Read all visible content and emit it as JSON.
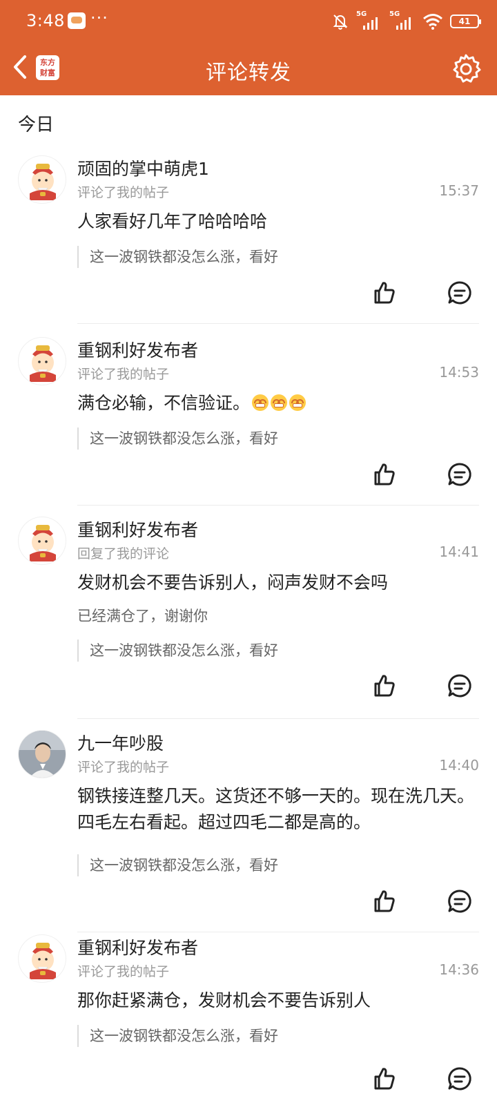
{
  "status_bar": {
    "time": "3:48",
    "more": "···",
    "network1": "5G",
    "network2": "5G",
    "battery": "41"
  },
  "nav": {
    "logo_line1": "东方",
    "logo_line2": "财富",
    "title": "评论转发"
  },
  "section": {
    "title": "今日"
  },
  "items": [
    {
      "username": "顽固的掌中萌虎1",
      "action": "评论了我的帖子",
      "time": "15:37",
      "comment": "人家看好几年了哈哈哈哈",
      "quote": "这一波钢铁都没怎么涨，看好",
      "avatar": "fortune-god"
    },
    {
      "username": "重钢利好发布者",
      "action": "评论了我的帖子",
      "time": "14:53",
      "comment": "满仓必输，不信验证。",
      "emoji_count": 3,
      "quote": "这一波钢铁都没怎么涨，看好",
      "avatar": "fortune-god"
    },
    {
      "username": "重钢利好发布者",
      "action": "回复了我的评论",
      "time": "14:41",
      "comment": "发财机会不要告诉别人，闷声发财不会吗",
      "reply": "已经满仓了，谢谢你",
      "quote": "这一波钢铁都没怎么涨，看好",
      "avatar": "fortune-god"
    },
    {
      "username": "九一年吵股",
      "action": "评论了我的帖子",
      "time": "14:40",
      "comment": "钢铁接连整几天。这货还不够一天的。现在洗几天。四毛左右看起。超过四毛二都是高的。",
      "quote": "这一波钢铁都没怎么涨，看好",
      "avatar": "photo"
    },
    {
      "username": "重钢利好发布者",
      "action": "评论了我的帖子",
      "time": "14:36",
      "comment": "那你赶紧满仓，发财机会不要告诉别人",
      "quote": "这一波钢铁都没怎么涨，看好",
      "avatar": "fortune-god"
    }
  ],
  "colors": {
    "accent": "#dd6130",
    "muted": "#999999",
    "text": "#222222"
  },
  "icons": [
    "back-icon",
    "logo-icon",
    "settings-icon",
    "like-icon",
    "comment-icon",
    "laugh-emoji-icon"
  ]
}
